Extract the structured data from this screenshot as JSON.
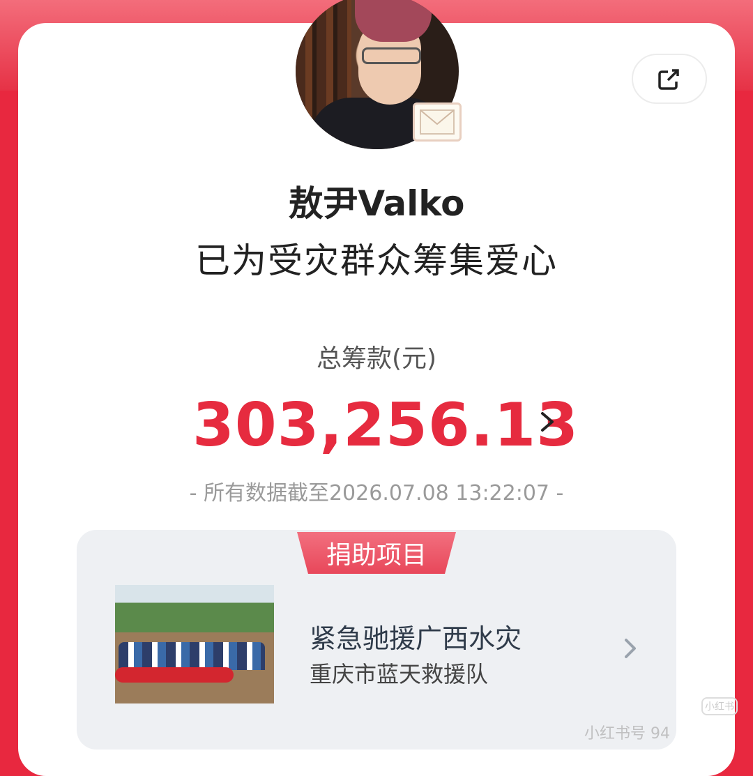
{
  "profile": {
    "name": "敖尹Valko",
    "subtitle": "已为受灾群众筹集爱心"
  },
  "total": {
    "label": "总筹款(元)",
    "amount": "303,256.13",
    "timestamp": "- 所有数据截至2026.07.08 13:22:07 -"
  },
  "project": {
    "section_label": "捐助项目",
    "title": "紧急驰援广西水灾",
    "organization": "重庆市蓝天救援队"
  },
  "watermark": {
    "text": "小红书号 94",
    "logo": "小红书"
  },
  "colors": {
    "accent": "#e62b3f",
    "tab": "#e8475a"
  }
}
